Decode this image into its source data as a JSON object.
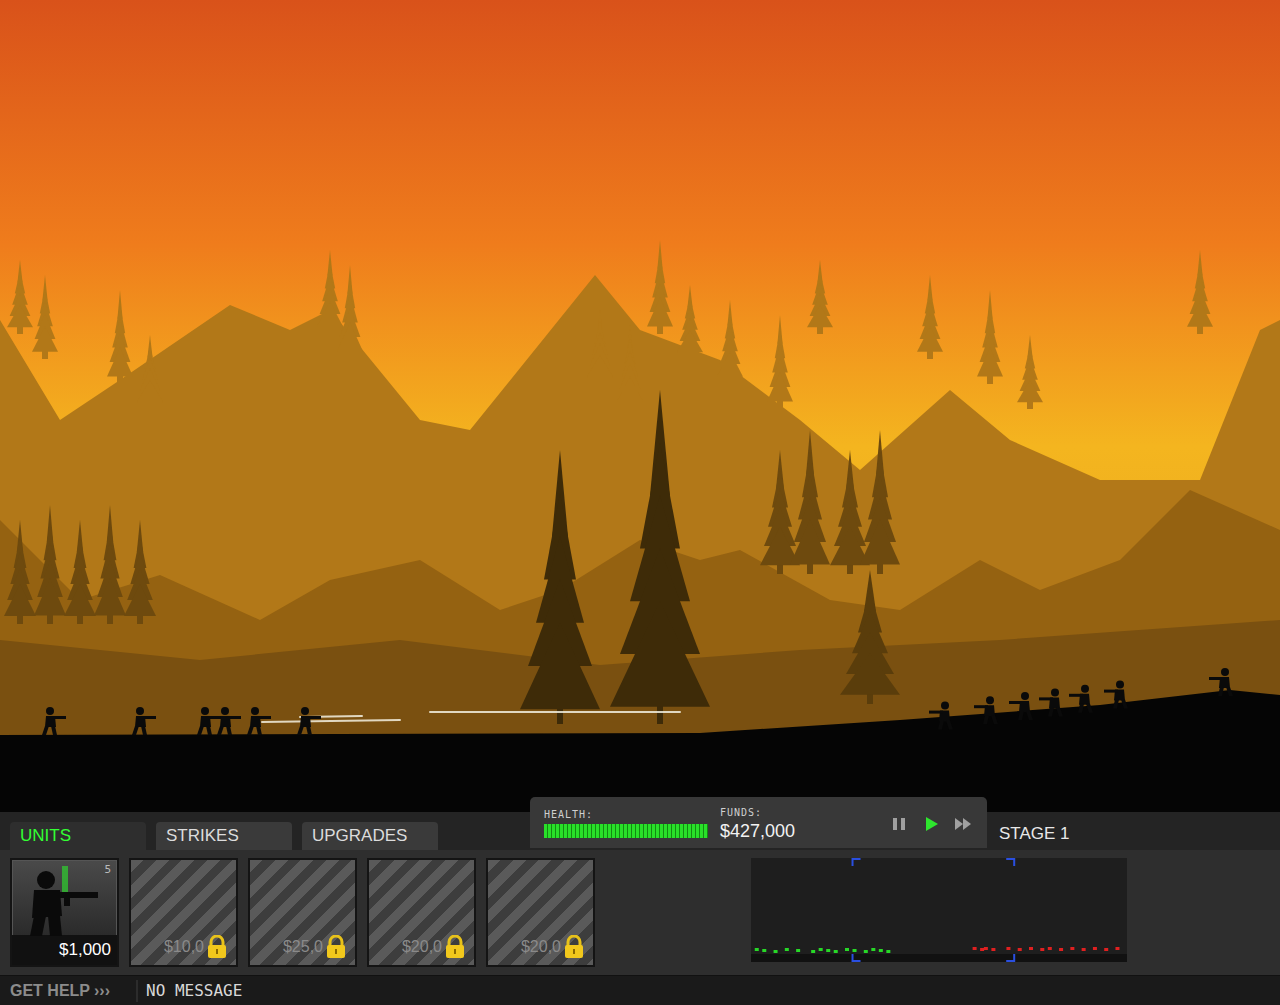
{
  "tabs": [
    {
      "label": "UNITS",
      "selected": true
    },
    {
      "label": "STRIKES",
      "selected": false
    },
    {
      "label": "UPGRADES",
      "selected": false
    }
  ],
  "status": {
    "health_label": "HEALTH:",
    "health": {
      "level": 1.0
    },
    "funds_label": "FUNDS:",
    "funds": "$427,000",
    "controls": [
      {
        "kind": "pause",
        "selected": false
      },
      {
        "kind": "play",
        "selected": true
      },
      {
        "kind": "fast-forward",
        "selected": false
      }
    ]
  },
  "stage": "STAGE 1",
  "units": [
    {
      "price": "$1,000",
      "count": "5",
      "locked": false,
      "selected": true
    },
    {
      "price": "$10,0",
      "locked": true,
      "selected": false
    },
    {
      "price": "$25,0",
      "locked": true,
      "selected": false
    },
    {
      "price": "$20,0",
      "locked": true,
      "selected": false
    },
    {
      "price": "$20,0",
      "locked": true,
      "selected": false
    }
  ],
  "battlefield": {
    "friendly": [
      50,
      140,
      205,
      225,
      255,
      305
    ],
    "enemy": [
      945,
      990,
      1025,
      1055,
      1085,
      1120,
      1225
    ],
    "tracers": [
      [
        262,
        400
      ],
      [
        300,
        362
      ],
      [
        430,
        680
      ]
    ]
  },
  "minimap": {
    "view": [
      0.27,
      0.7
    ],
    "friendly": [
      0.01,
      0.03,
      0.06,
      0.09,
      0.12,
      0.16,
      0.18,
      0.2,
      0.22,
      0.25,
      0.27,
      0.3,
      0.32,
      0.34,
      0.36
    ],
    "enemy": [
      0.6,
      0.62,
      0.63,
      0.65,
      0.69,
      0.72,
      0.75,
      0.78,
      0.8,
      0.83,
      0.86,
      0.89,
      0.92,
      0.95,
      0.98
    ]
  },
  "footer": {
    "help": "GET HELP",
    "arrows": "›››",
    "message": "NO MESSAGE"
  }
}
